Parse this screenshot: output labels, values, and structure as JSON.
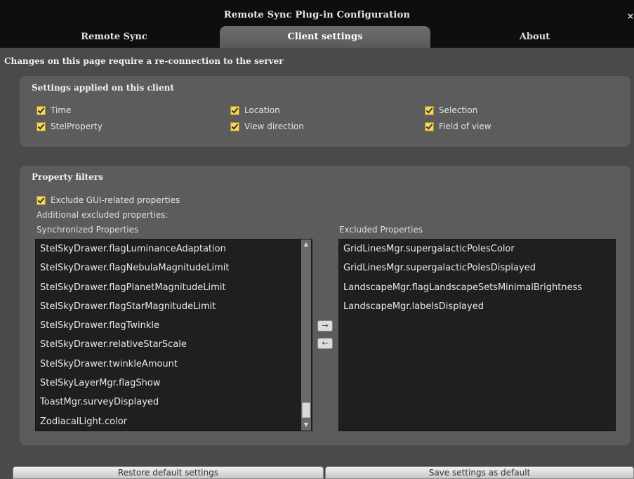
{
  "window": {
    "title": "Remote Sync Plug-in Configuration",
    "close_glyph": "×"
  },
  "tabs": [
    {
      "label": "Remote Sync",
      "active": false
    },
    {
      "label": "Client settings",
      "active": true
    },
    {
      "label": "About",
      "active": false
    }
  ],
  "notice": "Changes on this page require a re-connection to the server",
  "client_settings": {
    "title": "Settings applied on this client",
    "options": [
      {
        "label": "Time",
        "checked": true
      },
      {
        "label": "StelProperty",
        "checked": true
      },
      {
        "label": "Location",
        "checked": true
      },
      {
        "label": "View direction",
        "checked": true
      },
      {
        "label": "Selection",
        "checked": true
      },
      {
        "label": "Field of view",
        "checked": true
      }
    ]
  },
  "property_filters": {
    "title": "Property filters",
    "exclude_gui": {
      "label": "Exclude GUI-related properties",
      "checked": true
    },
    "additional_label": "Additional excluded properties:",
    "synchronized_label": "Synchronized Properties",
    "excluded_label": "Excluded Properties",
    "synchronized": [
      "StelSkyDrawer.flagLuminanceAdaptation",
      "StelSkyDrawer.flagNebulaMagnitudeLimit",
      "StelSkyDrawer.flagPlanetMagnitudeLimit",
      "StelSkyDrawer.flagStarMagnitudeLimit",
      "StelSkyDrawer.flagTwinkle",
      "StelSkyDrawer.relativeStarScale",
      "StelSkyDrawer.twinkleAmount",
      "StelSkyLayerMgr.flagShow",
      "ToastMgr.surveyDisplayed",
      "ZodiacalLight.color"
    ],
    "excluded": [
      "GridLinesMgr.supergalacticPolesColor",
      "GridLinesMgr.supergalacticPolesDisplayed",
      "LandscapeMgr.flagLandscapeSetsMinimalBrightness",
      "LandscapeMgr.labelsDisplayed"
    ],
    "move_right_glyph": "→",
    "move_left_glyph": "←",
    "scroll_up_glyph": "▲",
    "scroll_down_glyph": "▼"
  },
  "buttons": {
    "restore": "Restore default settings",
    "save": "Save settings as default"
  }
}
